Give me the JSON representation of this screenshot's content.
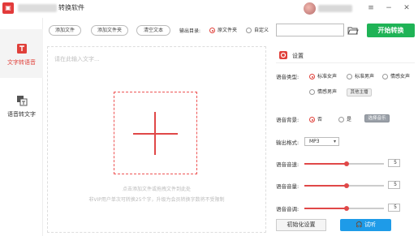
{
  "titlebar": {
    "app_icon": "app-logo-icon",
    "title": "转换软件",
    "avatar": "user-avatar"
  },
  "sidebar": {
    "items": [
      {
        "label": "文字转语音",
        "icon": "text-to-speech-icon",
        "active": true
      },
      {
        "label": "语音转文字",
        "icon": "speech-to-text-icon",
        "active": false
      }
    ]
  },
  "toolbar": {
    "add_file": "添加文件",
    "add_folder": "添加文件夹",
    "clear_text": "清空文本",
    "output_dir_label": "输出目录:",
    "output_options": [
      {
        "label": "原文件夹",
        "selected": true
      },
      {
        "label": "自定义",
        "selected": false
      }
    ],
    "path_value": "",
    "start": "开始转换"
  },
  "editor": {
    "placeholder": "请在此输入文字...",
    "hint_line1": "点击添加文件或拖拽文件到此处",
    "hint_line2": "非VIP用户单次可转换25个字，升级为会员转换字数将不受限制"
  },
  "settings": {
    "title": "设置",
    "voice_type_label": "语音类型:",
    "voice_types": [
      {
        "label": "标准女声",
        "selected": true
      },
      {
        "label": "标准男声",
        "selected": false
      },
      {
        "label": "情感女声",
        "selected": false
      },
      {
        "label": "情感男声",
        "selected": false
      }
    ],
    "other_anchor": "其他主播",
    "bg_label": "语音背景:",
    "bg_options": [
      {
        "label": "否",
        "selected": true
      },
      {
        "label": "是",
        "selected": false
      }
    ],
    "bg_music_btn": "选择音乐",
    "format_label": "输出格式:",
    "format_value": "MP3",
    "speed_label": "语音音速:",
    "speed_value": "5",
    "volume_label": "语音音量:",
    "volume_value": "5",
    "pitch_label": "语音音调:",
    "pitch_value": "5",
    "slider_fraction": 0.53,
    "init_btn": "初始化设置",
    "listen_btn": "试听"
  },
  "colors": {
    "accent": "#e0403a",
    "start_green": "#1fb356",
    "listen_blue": "#1e9be8"
  }
}
